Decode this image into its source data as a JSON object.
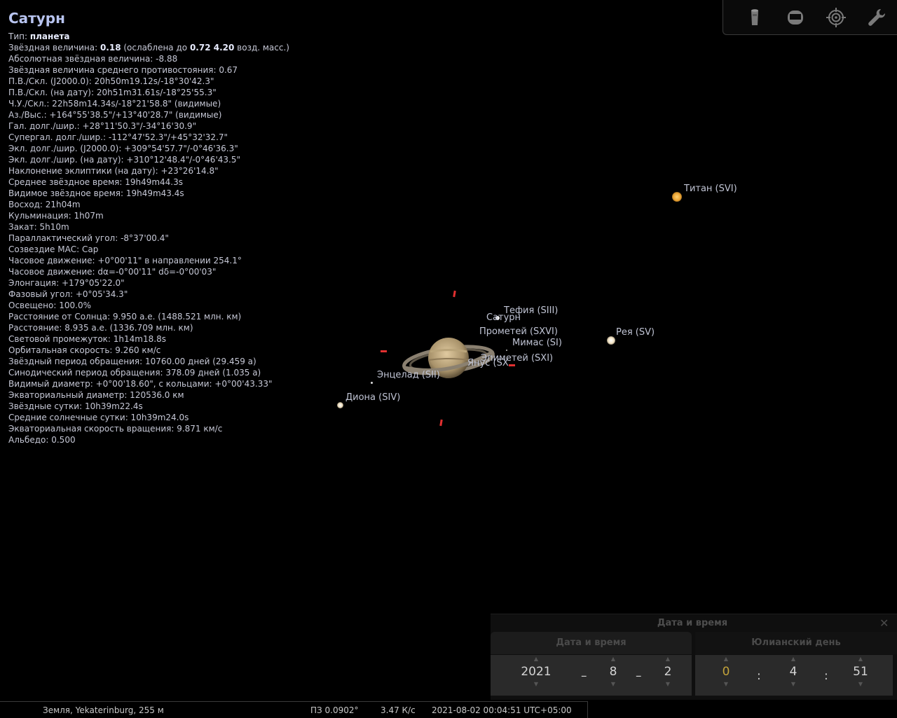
{
  "object": {
    "name": "Сатурн",
    "lines": [
      {
        "label": "Тип: ",
        "strong": "планета",
        "rest": ""
      },
      {
        "label": "Звёздная величина: ",
        "strong": "0.18",
        "rest": " (ослаблена до ",
        "strong2": "0.72 4.20",
        "rest2": " возд. масс.)"
      },
      {
        "label": "Абсолютная звёздная величина: -8.88"
      },
      {
        "label": "Звёздная величина среднего противостояния: 0.67"
      },
      {
        "label": "П.В./Скл. (J2000.0): 20h50m19.12s/-18°30'42.3\""
      },
      {
        "label": "П.В./Скл. (на дату): 20h51m31.61s/-18°25'55.3\""
      },
      {
        "label": "Ч.У./Скл.: 22h58m14.34s/-18°21'58.8\" (видимые)"
      },
      {
        "label": "Аз./Выс.: +164°55'38.5\"/+13°40'28.7\" (видимые)"
      },
      {
        "label": "Гал. долг./шир.: +28°11'50.3\"/-34°16'30.9\""
      },
      {
        "label": "Супергал. долг./шир.: -112°47'52.3\"/+45°32'32.7\""
      },
      {
        "label": "Экл. долг./шир. (J2000.0): +309°54'57.7\"/-0°46'36.3\""
      },
      {
        "label": "Экл. долг./шир. (на дату): +310°12'48.4\"/-0°46'43.5\""
      },
      {
        "label": "Наклонение эклиптики (на дату): +23°26'14.8\""
      },
      {
        "label": "Среднее звёздное время: 19h49m44.3s"
      },
      {
        "label": "Видимое звёздное время: 19h49m43.4s"
      },
      {
        "label": "Восход: 21h04m"
      },
      {
        "label": "Кульминация: 1h07m"
      },
      {
        "label": "Закат: 5h10m"
      },
      {
        "label": "Параллактический угол: -8°37'00.4\""
      },
      {
        "label": "Созвездие МАС: Cap"
      },
      {
        "label": "Часовое движение: +0°00'11\" в направлении 254.1°"
      },
      {
        "label": "Часовое движение: dα=-0°00'11\" dδ=-0°00'03\""
      },
      {
        "label": "Элонгация: +179°05'22.0\""
      },
      {
        "label": "Фазовый угол: +0°05'34.3\""
      },
      {
        "label": "Освещено: 100.0%"
      },
      {
        "label": "Расстояние от Солнца: 9.950 а.е. (1488.521 млн. км)"
      },
      {
        "label": "Расстояние: 8.935 а.е. (1336.709 млн. км)"
      },
      {
        "label": "Световой промежуток: 1h14m18.8s"
      },
      {
        "label": "Орбитальная скорость: 9.260 км/с"
      },
      {
        "label": "Звёздный период обращения: 10760.00 дней (29.459 а)"
      },
      {
        "label": "Синодический период обращения: 378.09 дней (1.035 а)"
      },
      {
        "label": "Видимый диаметр: +0°00'18.60\", с кольцами: +0°00'43.33\""
      },
      {
        "label": "Экваториальный диаметр: 120536.0 км"
      },
      {
        "label": "Звёздные сутки: 10h39m22.4s"
      },
      {
        "label": "Средние солнечные сутки: 10h39m24.0s"
      },
      {
        "label": "Экваториальная скорость вращения: 9.871 км/с"
      },
      {
        "label": "Альбедо: 0.500"
      }
    ]
  },
  "sky": {
    "labels": {
      "titan": "Титан (SVI)",
      "tethys": "Тефия (SIII)",
      "saturn": "Сатурн",
      "prometheus": "Прометей (SXVI)",
      "rhea": "Рея (SV)",
      "mimas": "Мимас (SI)",
      "epimetheus": "Эпиметей (SXI)",
      "janus": "Янус (SX)",
      "enceladus": "Энцелад (SII)",
      "dione": "Диона (SIV)"
    }
  },
  "datetime_panel": {
    "title": "Дата и время",
    "tab_date": "Дата и время",
    "tab_jd": "Юлианский день",
    "year": "2021",
    "month": "8",
    "day": "2",
    "hour": "0",
    "minute": "4",
    "second": "51",
    "date_sep": "–",
    "time_sep": ":",
    "up_arrow": "▲",
    "down_arrow": "▼",
    "close": "✕"
  },
  "statusbar": {
    "location": "Земля, Yekaterinburg, 255 м",
    "fov": "ПЗ 0.0902°",
    "fps": "3.47 К/с",
    "datetime": "2021-08-02 00:04:51 UTC+05:00"
  }
}
